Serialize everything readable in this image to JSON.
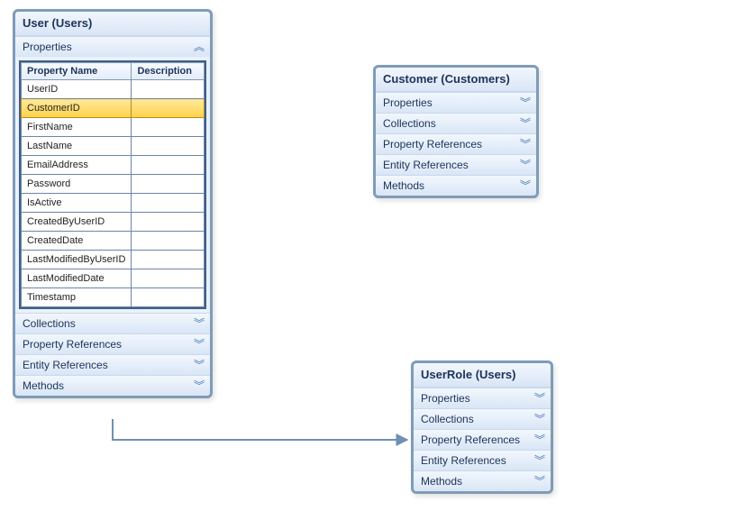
{
  "entities": {
    "user": {
      "title": "User (Users)",
      "sections": {
        "properties": "Properties",
        "collections": "Collections",
        "propertyReferences": "Property References",
        "entityReferences": "Entity References",
        "methods": "Methods"
      },
      "propTable": {
        "headers": {
          "name": "Property Name",
          "description": "Description"
        },
        "rows": [
          {
            "name": "UserID",
            "description": "",
            "selected": false
          },
          {
            "name": "CustomerID",
            "description": "",
            "selected": true
          },
          {
            "name": "FirstName",
            "description": "",
            "selected": false
          },
          {
            "name": "LastName",
            "description": "",
            "selected": false
          },
          {
            "name": "EmailAddress",
            "description": "",
            "selected": false
          },
          {
            "name": "Password",
            "description": "",
            "selected": false
          },
          {
            "name": "IsActive",
            "description": "",
            "selected": false
          },
          {
            "name": "CreatedByUserID",
            "description": "",
            "selected": false
          },
          {
            "name": "CreatedDate",
            "description": "",
            "selected": false
          },
          {
            "name": "LastModifiedByUserID",
            "description": "",
            "selected": false
          },
          {
            "name": "LastModifiedDate",
            "description": "",
            "selected": false
          },
          {
            "name": "Timestamp",
            "description": "",
            "selected": false
          }
        ]
      }
    },
    "customer": {
      "title": "Customer (Customers)",
      "sections": {
        "properties": "Properties",
        "collections": "Collections",
        "propertyReferences": "Property References",
        "entityReferences": "Entity References",
        "methods": "Methods"
      }
    },
    "userRole": {
      "title": "UserRole (Users)",
      "sections": {
        "properties": "Properties",
        "collections": "Collections",
        "propertyReferences": "Property References",
        "entityReferences": "Entity References",
        "methods": "Methods"
      }
    }
  },
  "glyphs": {
    "collapse": "︽",
    "expand": "︾"
  }
}
